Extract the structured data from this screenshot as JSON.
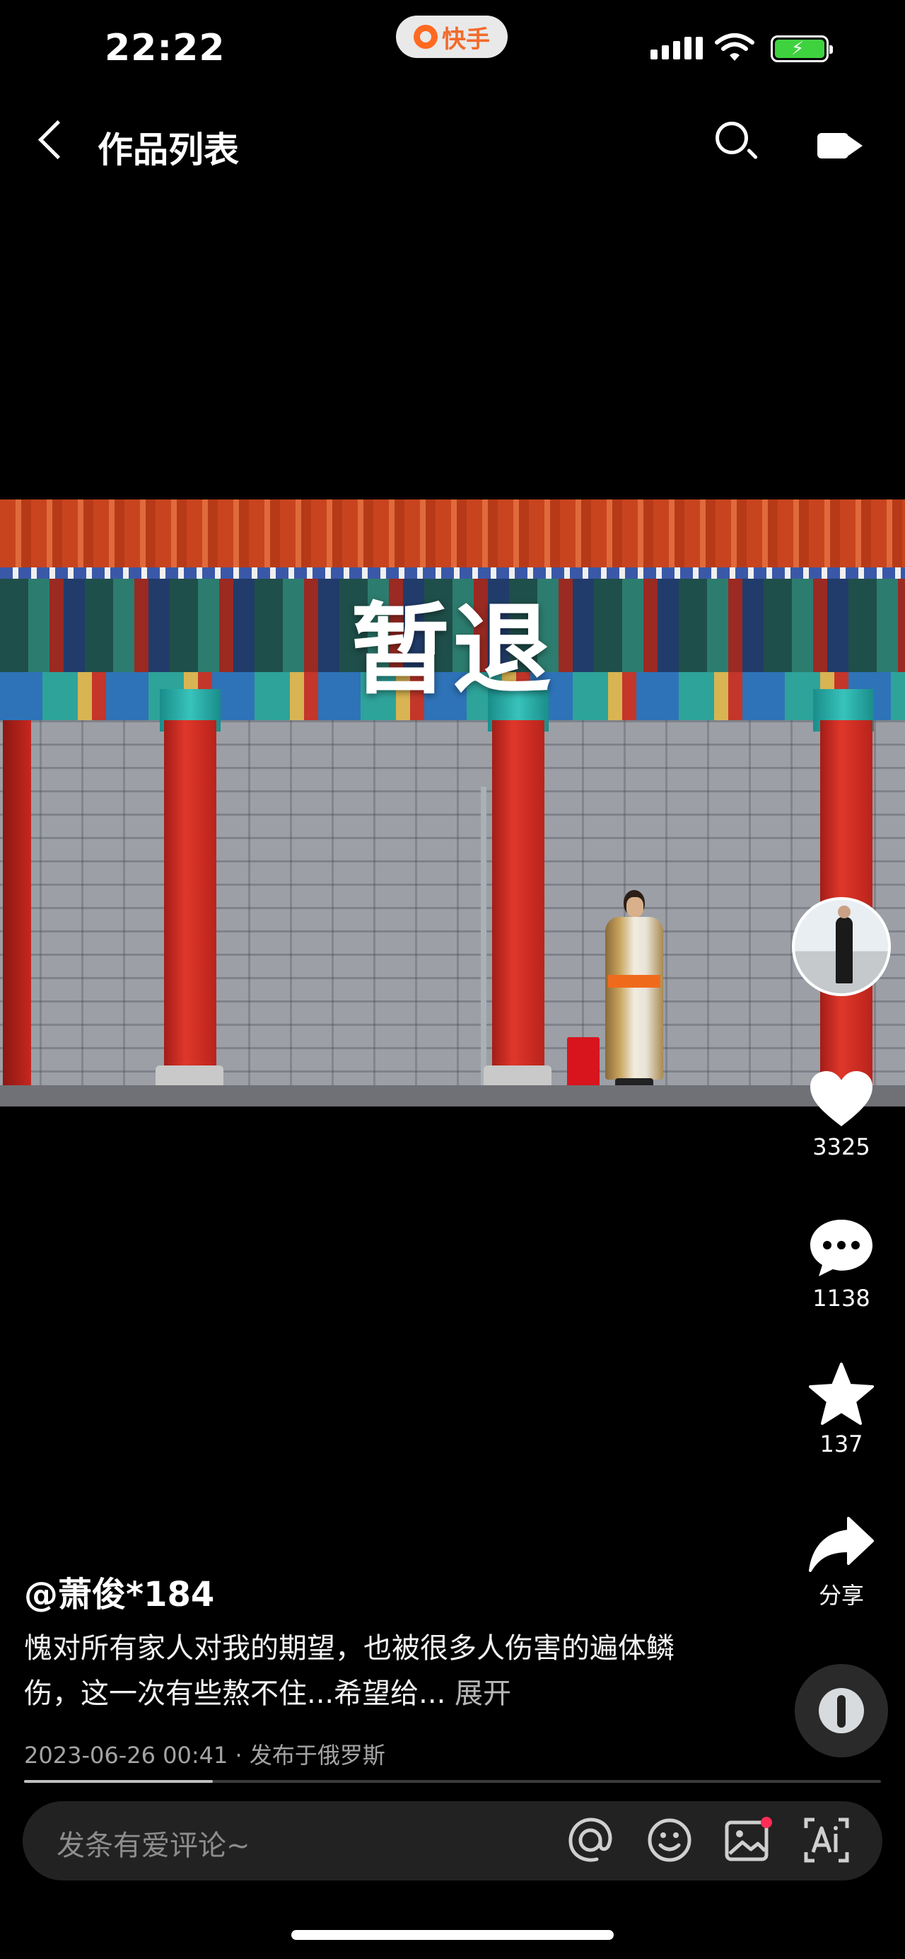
{
  "status_bar": {
    "time": "22:22",
    "app_badge": "快手"
  },
  "header": {
    "title": "作品列表"
  },
  "video": {
    "overlay_text": "暂退"
  },
  "actions": {
    "likes": "3325",
    "comments": "1138",
    "favorites": "137",
    "share_label": "分享"
  },
  "post": {
    "username": "@萧俊*184",
    "caption": "愧对所有家人对我的期望，也被很多人伤害的遍体鳞伤，这一次有些熬不住...希望给...",
    "expand_label": "展开",
    "meta": "2023-06-26 00:41 · 发布于俄罗斯",
    "progress": 0.22
  },
  "comment_bar": {
    "placeholder": "发条有爱评论~"
  },
  "colors": {
    "brand": "#ff6a21",
    "battery": "#3fd23f",
    "notify_dot": "#ff2d55"
  },
  "icons": [
    "back-icon",
    "search-icon",
    "camera-icon",
    "heart-icon",
    "comment-icon",
    "star-icon",
    "share-icon",
    "at-icon",
    "emoji-icon",
    "image-icon",
    "ai-icon"
  ]
}
